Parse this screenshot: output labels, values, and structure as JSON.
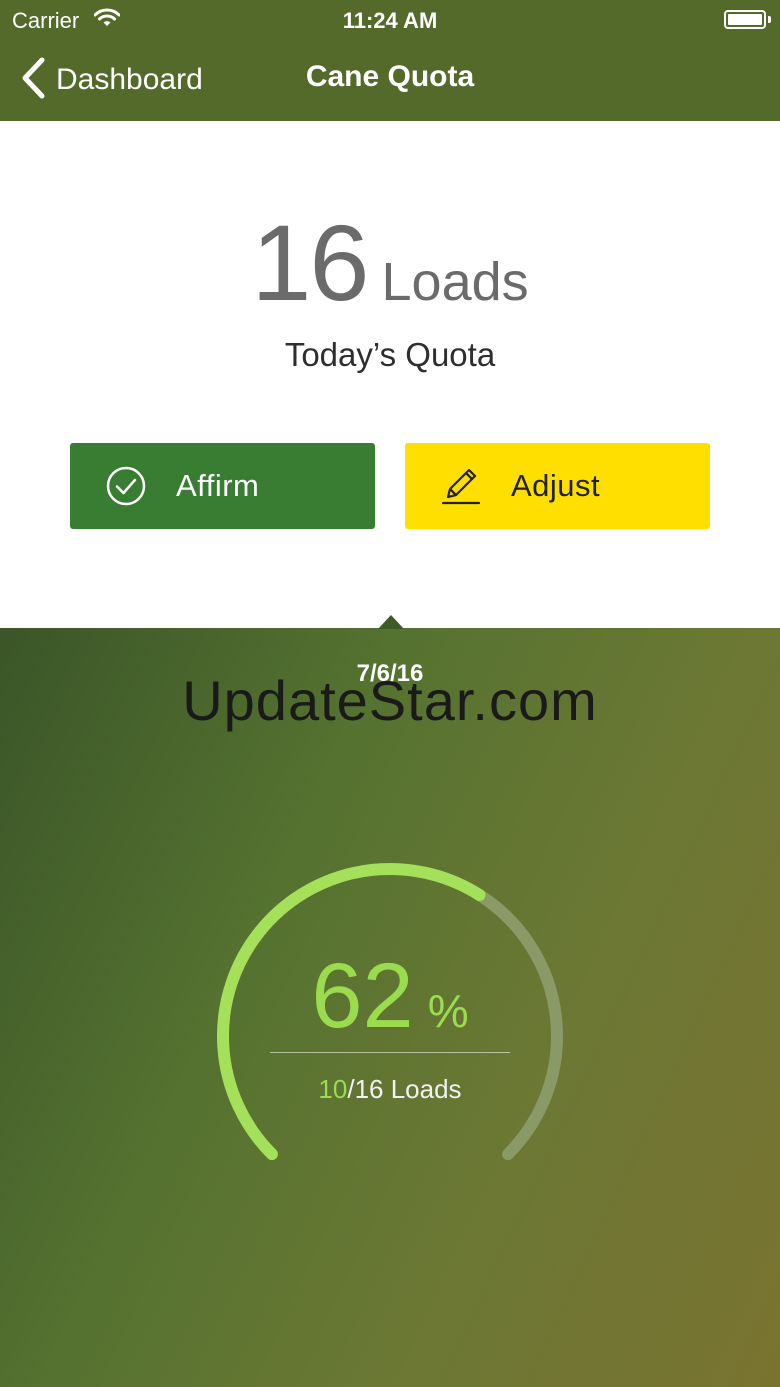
{
  "status_bar": {
    "carrier": "Carrier",
    "time": "11:24 AM",
    "icons": [
      "wifi-icon",
      "battery-icon"
    ]
  },
  "nav": {
    "back_label": "Dashboard",
    "title": "Cane Quota",
    "back_icon": "chevron-left-icon"
  },
  "quota": {
    "value": "16",
    "unit": "Loads",
    "caption": "Today’s Quota"
  },
  "actions": {
    "affirm_label": "Affirm",
    "affirm_icon": "check-circle-icon",
    "adjust_label": "Adjust",
    "adjust_icon": "pencil-icon"
  },
  "progress": {
    "date": "7/6/16",
    "percent": "62",
    "percent_symbol": "%",
    "percent_value": 62,
    "loads_done": "10",
    "loads_rest": "/16 Loads"
  },
  "watermark": "UpdateStar.com",
  "colors": {
    "nav_bar": "#546a2a",
    "affirm": "#387d32",
    "adjust": "#ffdf00",
    "gauge_progress": "#a4e05a",
    "gauge_track": "#8a9a66"
  }
}
